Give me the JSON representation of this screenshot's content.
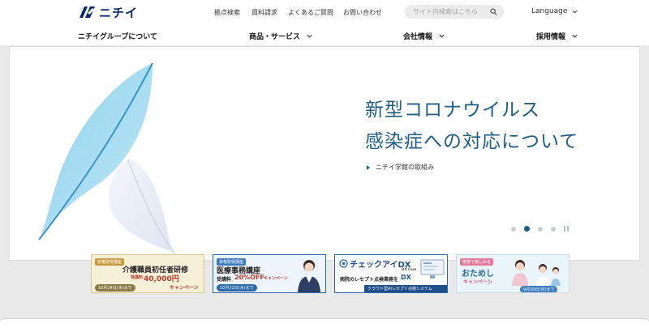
{
  "brand": {
    "name": "ニチイ",
    "color": "#0b2a6f"
  },
  "utility_links": [
    {
      "label": "拠点検索"
    },
    {
      "label": "資料請求"
    },
    {
      "label": "よくあるご質問"
    },
    {
      "label": "お問い合わせ"
    }
  ],
  "search": {
    "placeholder": "サイト内検索はこちら"
  },
  "language": {
    "label": "Language"
  },
  "nav": [
    {
      "label": "ニチイグループについて",
      "has_dropdown": false
    },
    {
      "label": "商品・サービス",
      "has_dropdown": true
    },
    {
      "label": "会社情報",
      "has_dropdown": true
    },
    {
      "label": "採用情報",
      "has_dropdown": true
    }
  ],
  "hero": {
    "title_line1": "新型コロナウイルス",
    "title_line2": "感染症への対応について",
    "link_label": "ニチイ学館の取組み",
    "accent_color": "#1d5e86",
    "slide_count": 4,
    "active_slide": 2
  },
  "banners": [
    {
      "tag": "資格取得講座",
      "title": "介護職員初任者研修",
      "offer_prefix": "受講料",
      "offer_value": "40,000円",
      "offer_suffix": "キャンペーン",
      "date": "10月24日(木)まで"
    },
    {
      "tag": "資格取得講座",
      "title": "医療事務講座",
      "offer_prefix": "受講料",
      "offer_value": "20%OFF",
      "offer_suffix": "キャンペーン",
      "date": "10月31日(木)まで"
    },
    {
      "title": "チェックアイDX",
      "title_sub": "DX Core",
      "desc": "病院のレセプト点検業務を",
      "desc_tag": "DX",
      "footer": "クラウド型AIレセプト点検システム"
    },
    {
      "tag": "家族で楽しめる",
      "title": "おためし",
      "subtitle": "キャンペーン",
      "date": "9月30日(月)まで"
    }
  ]
}
